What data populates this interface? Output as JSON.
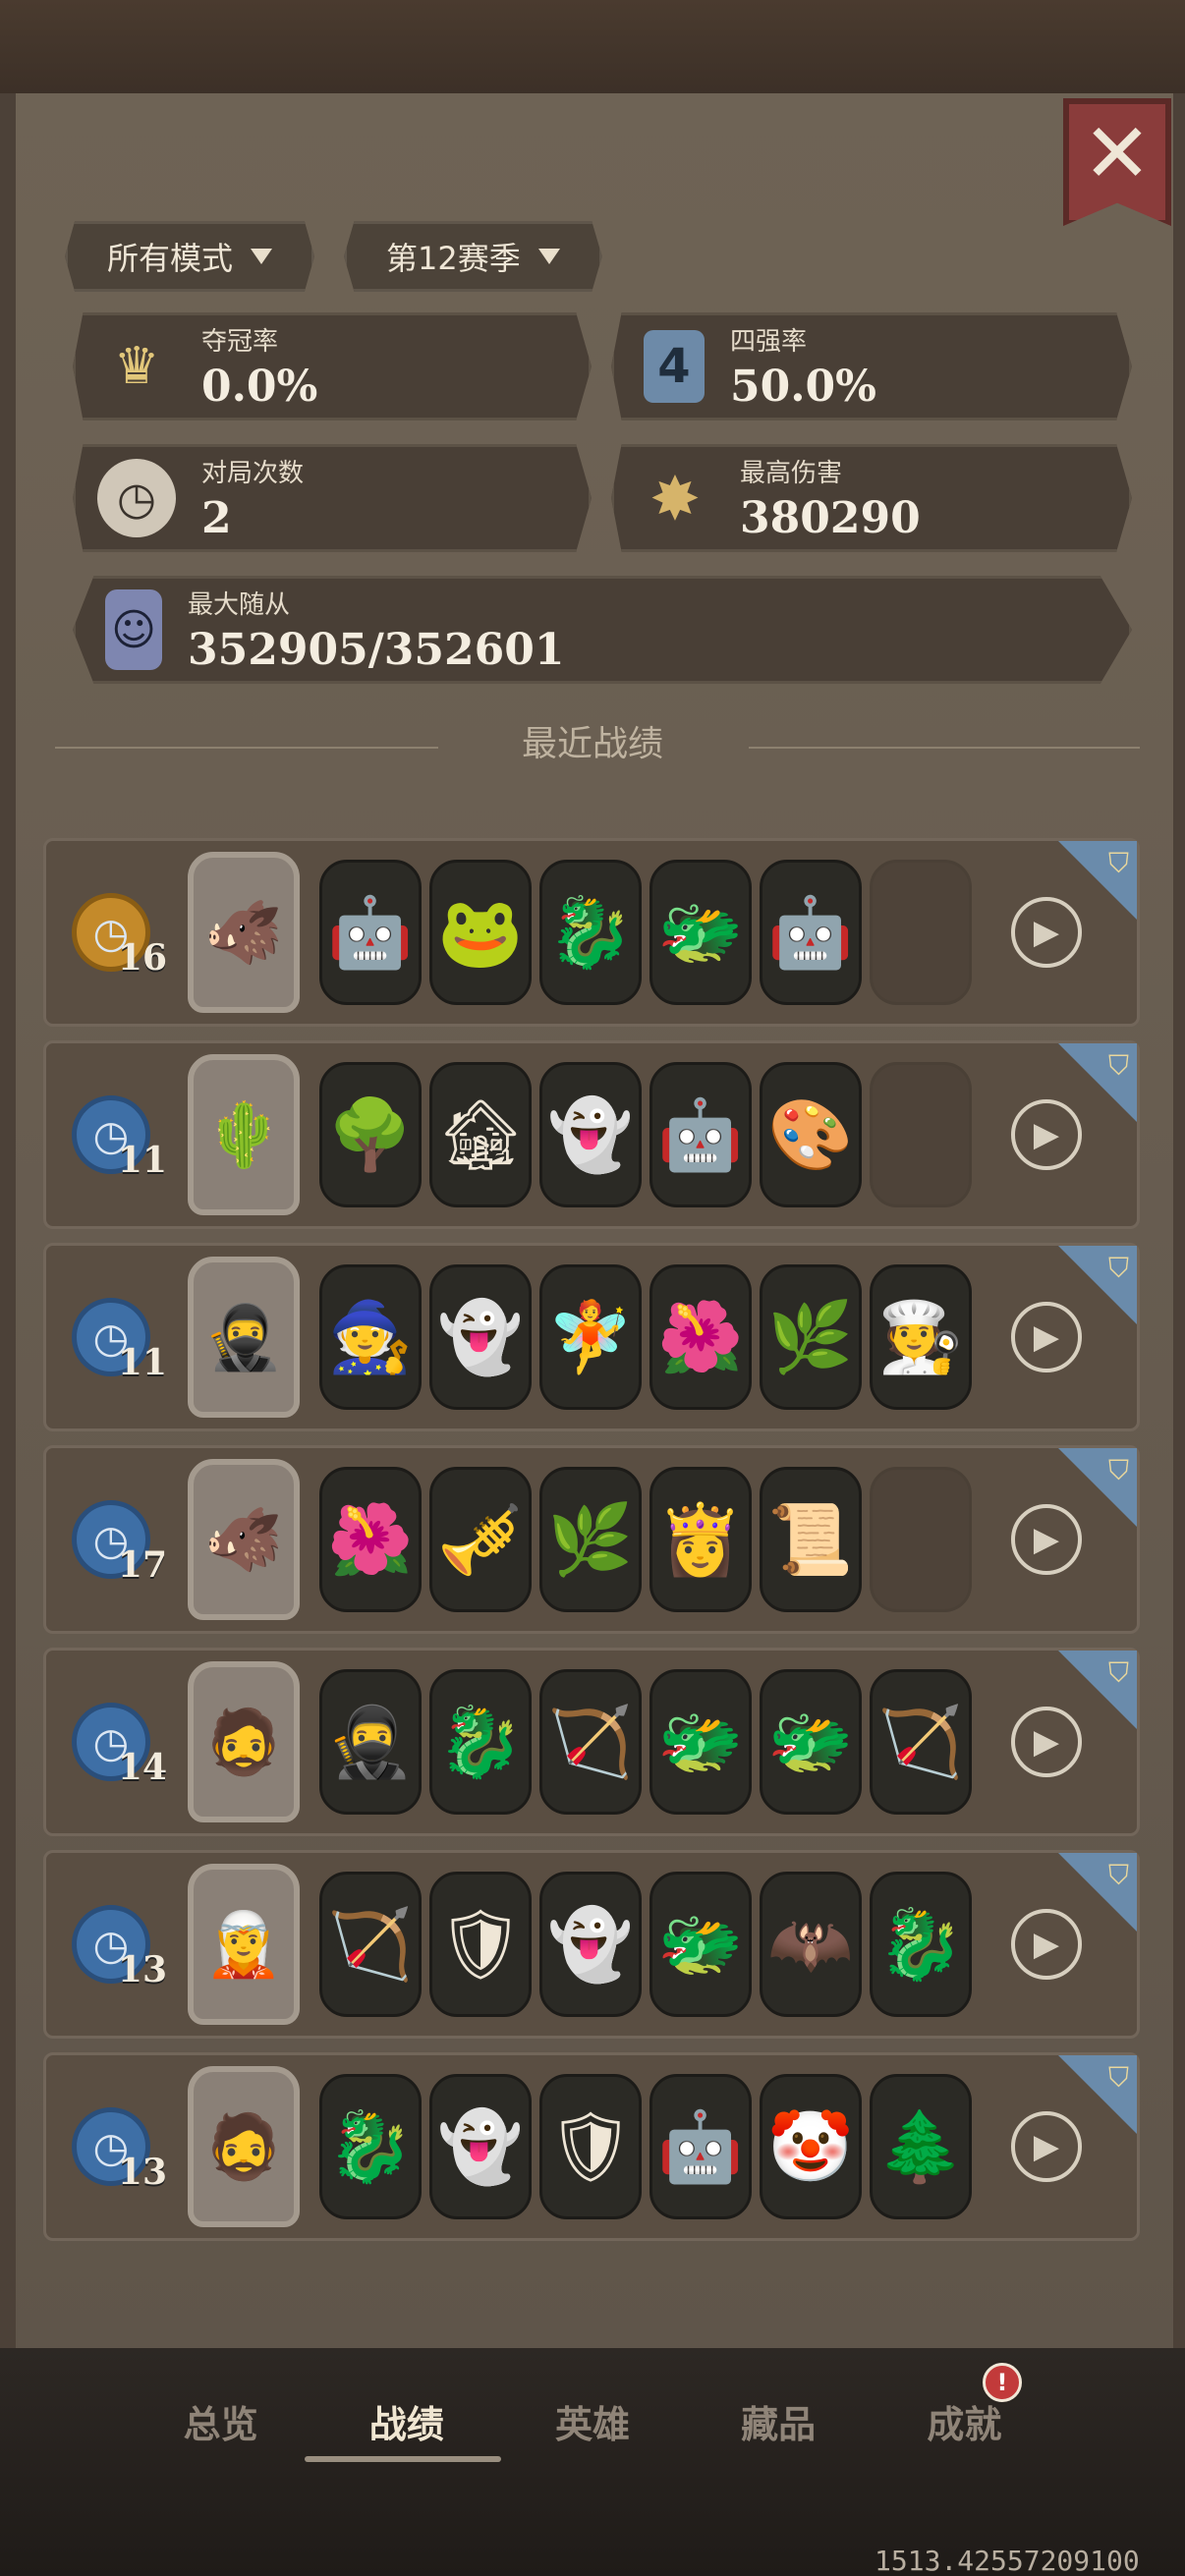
{
  "filters": {
    "mode": "所有模式",
    "season": "第12赛季"
  },
  "stats": {
    "champion_rate": {
      "label": "夺冠率",
      "value": "0.0%"
    },
    "top4_rate": {
      "label": "四强率",
      "value": "50.0%"
    },
    "matches": {
      "label": "对局次数",
      "value": "2"
    },
    "max_damage": {
      "label": "最高伤害",
      "value": "380290"
    },
    "max_minion": {
      "label": "最大随从",
      "value": "352905/352601"
    }
  },
  "section_title": "最近战绩",
  "records": [
    {
      "rank": "16",
      "badge": "gold",
      "hero": "🐗",
      "minions": [
        "🤖",
        "🐸",
        "🐉",
        "🐲",
        "🤖",
        ""
      ]
    },
    {
      "rank": "11",
      "badge": "blue",
      "hero": "🌵",
      "minions": [
        "🌳",
        "🏚",
        "👻",
        "🤖",
        "🎨",
        ""
      ]
    },
    {
      "rank": "11",
      "badge": "blue",
      "hero": "🥷",
      "minions": [
        "🧙",
        "👻",
        "🧚",
        "🌺",
        "🌿",
        "🧑‍🍳"
      ]
    },
    {
      "rank": "17",
      "badge": "blue",
      "hero": "🐗",
      "minions": [
        "🌺",
        "🎺",
        "🌿",
        "👸",
        "📜",
        ""
      ]
    },
    {
      "rank": "14",
      "badge": "blue",
      "hero": "🧔",
      "minions": [
        "🥷",
        "🐉",
        "🏹",
        "🐲",
        "🐲",
        "🏹"
      ]
    },
    {
      "rank": "13",
      "badge": "blue",
      "hero": "🧝",
      "minions": [
        "🏹",
        "🛡",
        "👻",
        "🐲",
        "🦇",
        "🐉"
      ]
    },
    {
      "rank": "13",
      "badge": "blue",
      "hero": "🧔",
      "minions": [
        "🐉",
        "👻",
        "🛡",
        "🤖",
        "🤡",
        "🌲"
      ]
    }
  ],
  "tabs": [
    "总览",
    "战绩",
    "英雄",
    "藏品",
    "成就"
  ],
  "notif": "!",
  "coords": "1513.42557209100"
}
